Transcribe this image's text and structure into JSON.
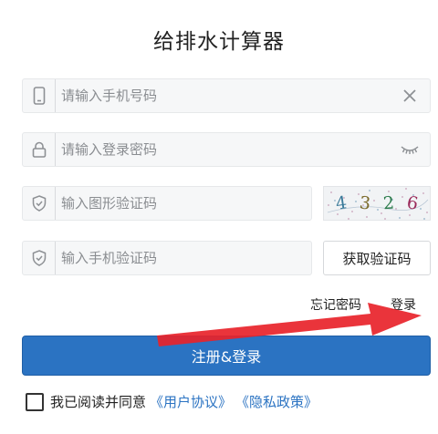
{
  "page": {
    "title": "给排水计算器"
  },
  "phone": {
    "placeholder": "请输入手机号码"
  },
  "password": {
    "placeholder": "请输入登录密码"
  },
  "captcha": {
    "placeholder": "输入图形验证码",
    "chars": [
      "4",
      "3",
      "2",
      "6"
    ]
  },
  "sms": {
    "placeholder": "输入手机验证码",
    "button_label": "获取验证码"
  },
  "links": {
    "forgot": "忘记密码",
    "login": "登录"
  },
  "submit": {
    "label": "注册&登录"
  },
  "agreement": {
    "text": "我已阅读并同意",
    "user_link": "《用户协议》",
    "privacy_link": "《隐私政策》"
  },
  "colors": {
    "accent": "#2b73c2",
    "annotation_arrow": "#e8232a"
  },
  "icons": [
    "phone-icon",
    "clear-icon",
    "lock-icon",
    "eye-closed-icon",
    "shield-check-icon"
  ]
}
